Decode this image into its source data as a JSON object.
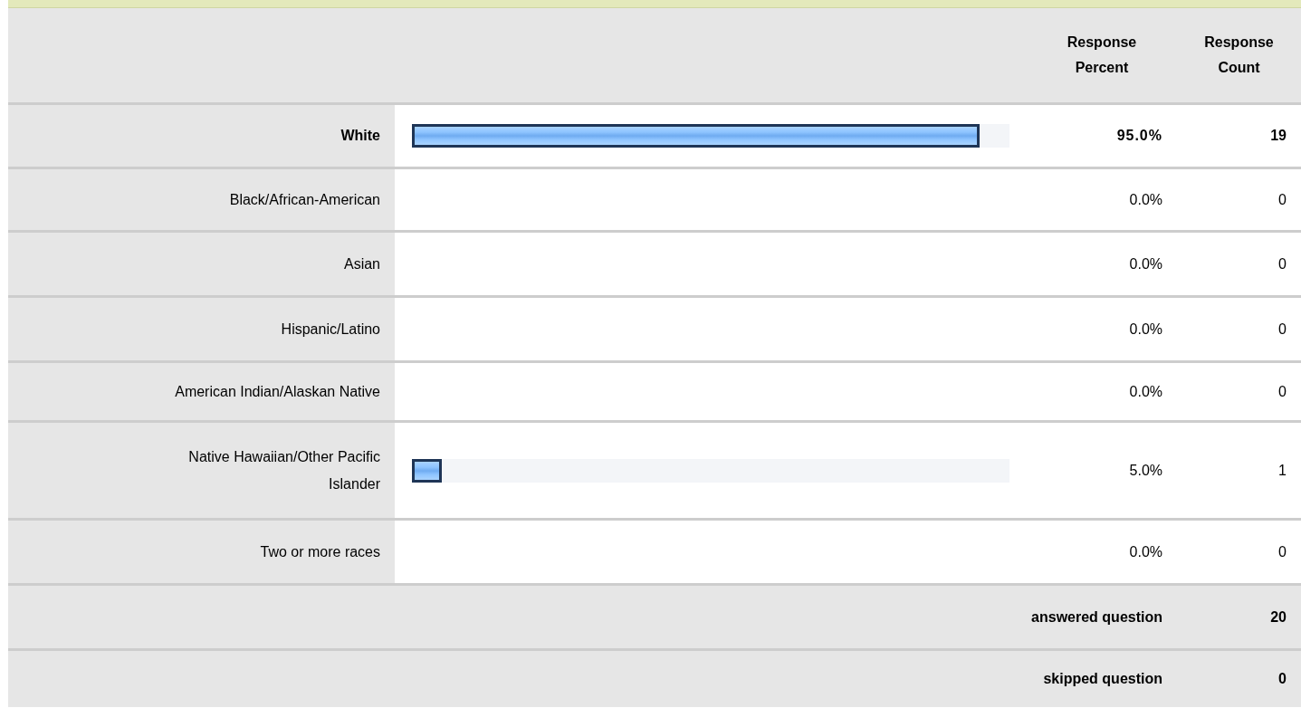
{
  "columns": {
    "percent": "Response Percent",
    "count": "Response Count"
  },
  "rows": [
    {
      "label": "White",
      "level": 0.95,
      "percent": "95.0%",
      "count": "19",
      "highlighted": true
    },
    {
      "label": "Black/African-American",
      "percent": "0.0%",
      "count": "0",
      "highlighted": false
    },
    {
      "label": "Asian",
      "percent": "0.0%",
      "count": "0",
      "highlighted": false
    },
    {
      "label": "Hispanic/Latino",
      "percent": "0.0%",
      "count": "0",
      "highlighted": false
    },
    {
      "label": "American Indian/Alaskan Native",
      "percent": "0.0%",
      "count": "0",
      "highlighted": false
    },
    {
      "label": "Native Hawaiian/Other Pacific Islander",
      "level": 0.05,
      "percent": "5.0%",
      "count": "1",
      "highlighted": false
    },
    {
      "label": "Two or more races",
      "percent": "0.0%",
      "count": "0",
      "highlighted": false
    }
  ],
  "totals": [
    {
      "label": "answered question",
      "value": "20"
    },
    {
      "label": "skipped question",
      "value": "0"
    }
  ]
}
